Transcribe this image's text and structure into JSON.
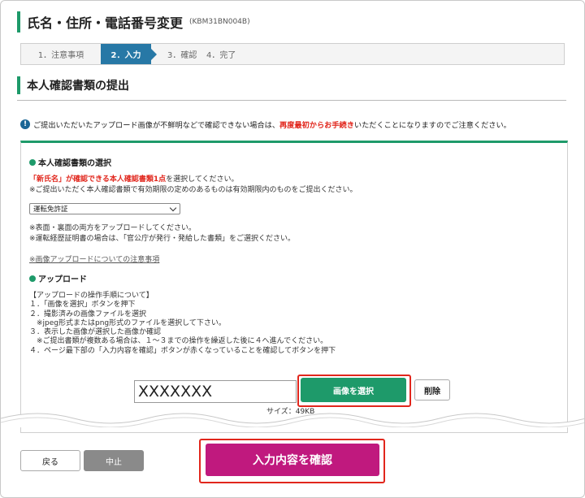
{
  "header": {
    "title": "氏名・住所・電話番号変更",
    "code": "(KBM31BN004B)"
  },
  "steps": [
    {
      "label": "1．注意事項"
    },
    {
      "label": "2．入力"
    },
    {
      "label": "3．確認"
    },
    {
      "label": "4．完了"
    }
  ],
  "section_title": "本人確認書類の提出",
  "notice": {
    "before": "ご提出いただいたアップロード画像が不鮮明などで確認できない場合は、",
    "highlight": "再度最初からお手続き",
    "after": "いただくことになりますのでご注意ください。"
  },
  "document": {
    "heading": "本人確認書類の選択",
    "line1_red": "「新氏名」が確認できる本人確認書類1点",
    "line1_rest": "を選択してください。",
    "line2": "※ご提出いただく本人確認書類で有効期限の定めのあるものは有効期限内のものをご提出ください。",
    "selected": "運転免許証",
    "note1": "※表面・裏面の両方をアップロードしてください。",
    "note2": "※運転経歴証明書の場合は、「官公庁が発行・発給した書類」をご選択ください。",
    "link": "※画像アップロードについての注意事項"
  },
  "upload": {
    "heading": "アップロード",
    "steps_text": "【アップロードの操作手順について】\n１．「画像を選択」ボタンを押下\n２．撮影済みの画像ファイルを選択\n　※jpeg形式またはpng形式のファイルを選択して下さい。\n３．表示した画像が選択した画像か確認\n　※ご提出書類が複数ある場合は、１～３までの操作を繰返した後に４へ進んでください。\n４．ページ最下部の「入力内容を確認」ボタンが赤くなっていることを確認してボタンを押下",
    "file_value": "XXXXXXX",
    "select_label": "画像を選択",
    "delete_label": "削除",
    "size_label": "サイズ：49KB"
  },
  "footer": {
    "back": "戻る",
    "cancel": "中止",
    "confirm": "入力内容を確認"
  },
  "colors": {
    "accent_green": "#1e9a6a",
    "step_active": "#2778a6",
    "warning_red": "#e1261c",
    "confirm_magenta": "#c0197e"
  }
}
